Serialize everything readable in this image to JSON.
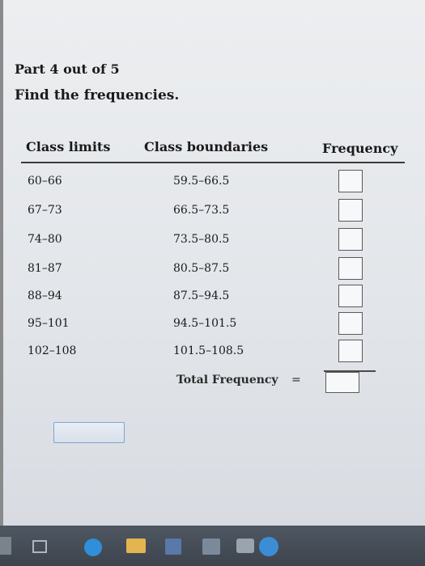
{
  "problem": {
    "part_label": "Part 4 out of 5",
    "instruction": "Find the frequencies."
  },
  "table": {
    "headers": {
      "class_limits": "Class limits",
      "class_boundaries": "Class boundaries",
      "frequency": "Frequency"
    },
    "rows": [
      {
        "limits": "60–66",
        "boundaries": "59.5–66.5",
        "frequency": ""
      },
      {
        "limits": "67–73",
        "boundaries": "66.5–73.5",
        "frequency": ""
      },
      {
        "limits": "74–80",
        "boundaries": "73.5–80.5",
        "frequency": ""
      },
      {
        "limits": "81–87",
        "boundaries": "80.5–87.5",
        "frequency": ""
      },
      {
        "limits": "88–94",
        "boundaries": "87.5–94.5",
        "frequency": ""
      },
      {
        "limits": "95–101",
        "boundaries": "94.5–101.5",
        "frequency": ""
      },
      {
        "limits": "102–108",
        "boundaries": "101.5–108.5",
        "frequency": ""
      }
    ],
    "total": {
      "label": "Total Frequency",
      "equals": "=",
      "value": ""
    }
  }
}
